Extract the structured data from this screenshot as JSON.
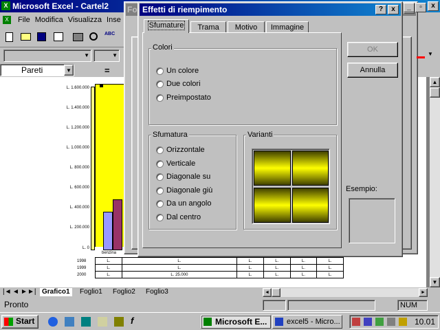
{
  "excel": {
    "title": "Microsoft Excel - Cartel2",
    "menu": [
      "File",
      "Modifica",
      "Visualizza",
      "Inse"
    ],
    "name_box": "Pareti",
    "formula_eq": "=",
    "y_ticks": [
      "L. 1.600.000",
      "L. 1.400.000",
      "L. 1.200.000",
      "L. 1.000.000",
      "L. 800.000",
      "L. 600.000",
      "L. 400.000",
      "L. 200.000",
      "L. 0"
    ],
    "x_category": "benzina",
    "table_rows": [
      {
        "label": "1998",
        "cells": [
          "L.",
          "L.",
          "L.",
          "L.",
          "L.",
          "L."
        ]
      },
      {
        "label": "1999",
        "cells": [
          "L.",
          "L.",
          "L.",
          "L.",
          "L.",
          "L."
        ]
      },
      {
        "label": "2000",
        "cells": [
          "L.",
          "L. 25.000",
          "L.",
          "L.",
          "L.",
          "L."
        ]
      }
    ],
    "sheet_tabs": [
      "Grafico1",
      "Foglio1",
      "Foglio2",
      "Foglio3"
    ],
    "status": "Pronto",
    "num": "NUM",
    "bg_window_title": "Fo"
  },
  "dialog": {
    "title": "Effetti di riempimento",
    "help": "?",
    "close": "x",
    "tabs": [
      "Sfumature",
      "Trama",
      "Motivo",
      "Immagine"
    ],
    "colori_label": "Colori",
    "colori_options": [
      "Un colore",
      "Due colori",
      "Preimpostato"
    ],
    "sfumatura_label": "Sfumatura",
    "sfumatura_options": [
      "Orizzontale",
      "Verticale",
      "Diagonale su",
      "Diagonale giù",
      "Da un angolo",
      "Dal centro"
    ],
    "varianti_label": "Varianti",
    "ok": "OK",
    "annulla": "Annulla",
    "esempio_label": "Esempio:"
  },
  "taskbar": {
    "start": "Start",
    "tasks": [
      "Microsoft E...",
      "excel5 - Micro..."
    ],
    "clock": "10.01"
  }
}
